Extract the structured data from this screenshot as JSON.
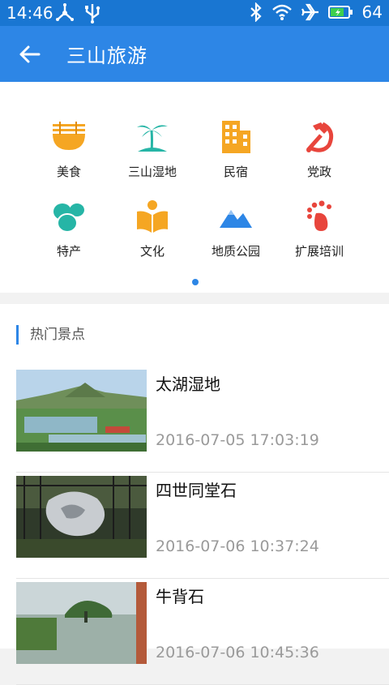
{
  "status": {
    "time": "14:46",
    "battery": "64"
  },
  "appbar": {
    "title": "三山旅游"
  },
  "categories": [
    {
      "label": "美食",
      "icon": "noodle-bowl-icon"
    },
    {
      "label": "三山湿地",
      "icon": "palm-island-icon"
    },
    {
      "label": "民宿",
      "icon": "building-icon"
    },
    {
      "label": "党政",
      "icon": "hammer-sickle-icon"
    },
    {
      "label": "特产",
      "icon": "eggs-icon"
    },
    {
      "label": "文化",
      "icon": "book-reader-icon"
    },
    {
      "label": "地质公园",
      "icon": "mountain-icon"
    },
    {
      "label": "扩展培训",
      "icon": "footprint-icon"
    }
  ],
  "section": {
    "title": "热门景点"
  },
  "items": [
    {
      "name": "太湖湿地",
      "date": "2016-07-05 17:03:19"
    },
    {
      "name": "四世同堂石",
      "date": "2016-07-06 10:37:24"
    },
    {
      "name": "牛背石",
      "date": "2016-07-06 10:45:36"
    }
  ],
  "colors": {
    "primary": "#2d86e6",
    "statusbar": "#1976d2",
    "orange": "#f5a623",
    "teal": "#26b5a6",
    "red": "#e8453c"
  }
}
